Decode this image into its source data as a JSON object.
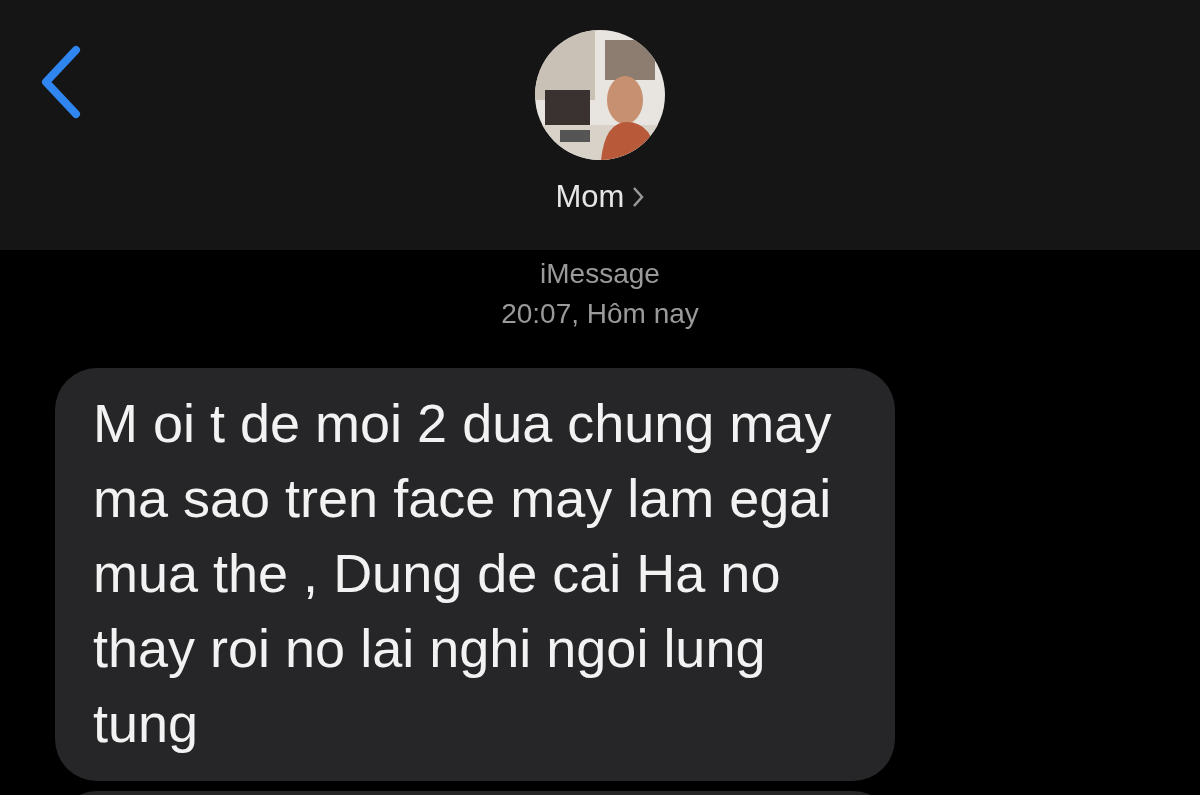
{
  "header": {
    "contact_name": "Mom"
  },
  "conversation": {
    "service": "iMessage",
    "timestamp": "20:07, Hôm nay",
    "messages": [
      {
        "text": "M oi t de moi 2 dua chung may ma sao tren face may lam egai mua the , Dung de cai Ha no thay roi no lai nghi ngoi lung tung",
        "incoming": true
      }
    ],
    "more_below": true
  }
}
